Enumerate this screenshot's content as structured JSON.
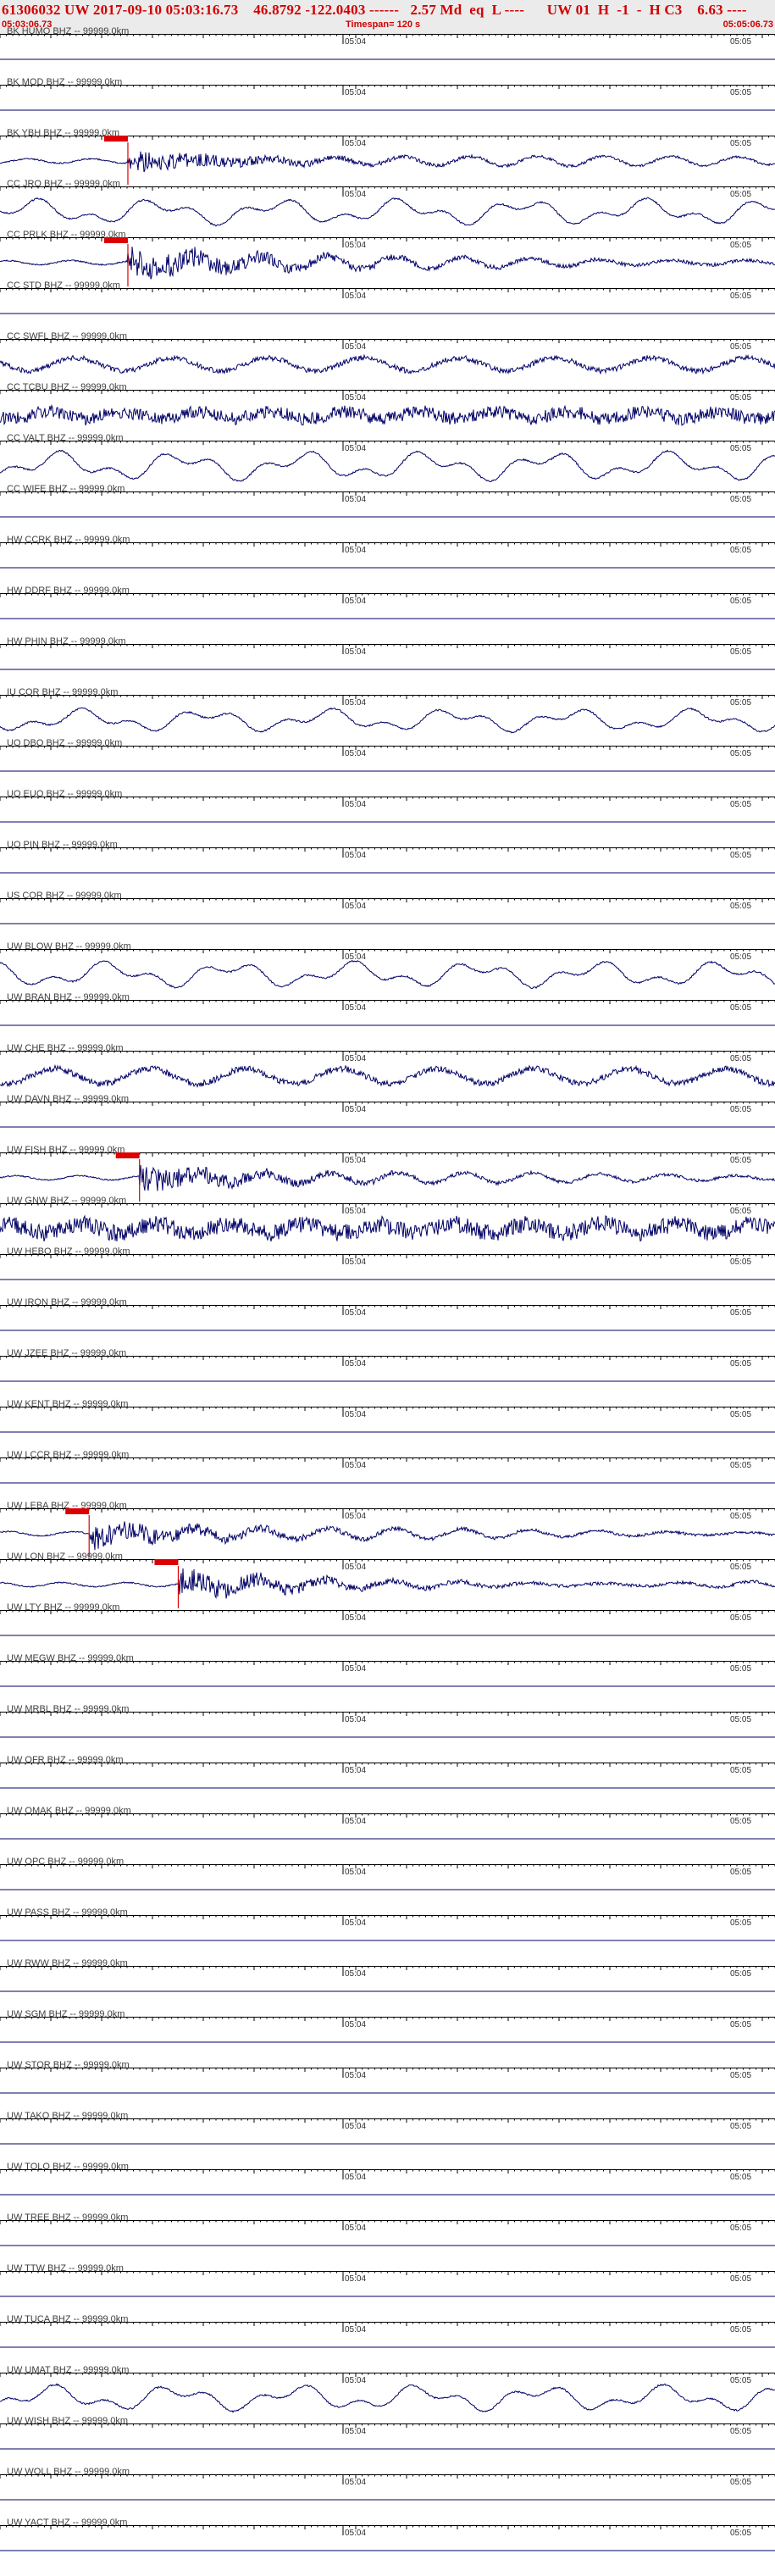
{
  "header": {
    "title": "61306032 UW 2017-09-10 05:03:16.73    46.8792 -122.0403 ------   2.57 Md  eq  L ----      UW 01  H  -1  -  H C3    6.63 ----",
    "start_time": "05:03:06.73",
    "timespan": "Timespan= 120 s",
    "end_time": "05:05:06.73"
  },
  "time_marks": {
    "mid": "05:04",
    "end": "05:05"
  },
  "colors": {
    "trace": "#000066",
    "pick": "#dd0000",
    "axis": "#000000",
    "header_text": "#d00000"
  },
  "stations": [
    {
      "label": "BK HUMO BHZ -- 99999.0km",
      "amp": 0,
      "style": "flat",
      "pick": null
    },
    {
      "label": "BK MOD BHZ -- 99999.0km",
      "amp": 0,
      "style": "flat",
      "pick": null
    },
    {
      "label": "BK YBH BHZ -- 99999.0km",
      "amp": 14,
      "style": "burst",
      "pick": 0.165
    },
    {
      "label": "CC JRO BHZ -- 99999.0km",
      "amp": 16,
      "style": "long",
      "pick": null
    },
    {
      "label": "CC PRLK BHZ -- 99999.0km",
      "amp": 20,
      "style": "burst",
      "pick": 0.165
    },
    {
      "label": "CC STD BHZ -- 99999.0km",
      "amp": 0,
      "style": "flat",
      "pick": null
    },
    {
      "label": "CC SWFL BHZ -- 99999.0km",
      "amp": 14,
      "style": "wave",
      "pick": null
    },
    {
      "label": "CC TCBU BHZ -- 99999.0km",
      "amp": 14,
      "style": "noise",
      "pick": null
    },
    {
      "label": "CC VALT BHZ -- 99999.0km",
      "amp": 18,
      "style": "long",
      "pick": null
    },
    {
      "label": "CC WIFE BHZ -- 99999.0km",
      "amp": 0,
      "style": "flat",
      "pick": null
    },
    {
      "label": "HW CCRK BHZ -- 99999.0km",
      "amp": 0,
      "style": "flat",
      "pick": null
    },
    {
      "label": "HW DDRF BHZ -- 99999.0km",
      "amp": 0,
      "style": "flat",
      "pick": null
    },
    {
      "label": "HW PHIN BHZ -- 99999.0km",
      "amp": 0,
      "style": "flat",
      "pick": null
    },
    {
      "label": "IU COR BHZ -- 99999.0km",
      "amp": 14,
      "style": "long",
      "pick": null
    },
    {
      "label": "UO DBO BHZ -- 99999.0km",
      "amp": 0,
      "style": "flat",
      "pick": null
    },
    {
      "label": "UO EUO BHZ -- 99999.0km",
      "amp": 0,
      "style": "flat",
      "pick": null
    },
    {
      "label": "UO PIN BHZ -- 99999.0km",
      "amp": 0,
      "style": "flat",
      "pick": null
    },
    {
      "label": "US COR BHZ -- 99999.0km",
      "amp": 0,
      "style": "flat",
      "pick": null
    },
    {
      "label": "UW BLOW BHZ -- 99999.0km",
      "amp": 16,
      "style": "long",
      "pick": null
    },
    {
      "label": "UW BRAN BHZ -- 99999.0km",
      "amp": 0,
      "style": "flat",
      "pick": null
    },
    {
      "label": "UW CHE BHZ -- 99999.0km",
      "amp": 16,
      "style": "wave",
      "pick": null
    },
    {
      "label": "UW DAVN BHZ -- 99999.0km",
      "amp": 0,
      "style": "flat",
      "pick": null
    },
    {
      "label": "UW FISH BHZ -- 99999.0km",
      "amp": 16,
      "style": "burst",
      "pick": 0.18
    },
    {
      "label": "UW GNW BHZ -- 99999.0km",
      "amp": 18,
      "style": "noise",
      "pick": null
    },
    {
      "label": "UW HEBO BHZ -- 99999.0km",
      "amp": 0,
      "style": "flat",
      "pick": null
    },
    {
      "label": "UW IRON BHZ -- 99999.0km",
      "amp": 0,
      "style": "flat",
      "pick": null
    },
    {
      "label": "UW JZEE BHZ -- 99999.0km",
      "amp": 0,
      "style": "flat",
      "pick": null
    },
    {
      "label": "UW KENT BHZ -- 99999.0km",
      "amp": 0,
      "style": "flat",
      "pick": null
    },
    {
      "label": "UW LCCR BHZ -- 99999.0km",
      "amp": 0,
      "style": "flat",
      "pick": null
    },
    {
      "label": "UW LEBA BHZ -- 99999.0km",
      "amp": 16,
      "style": "burst",
      "pick": 0.115
    },
    {
      "label": "UW LON BHZ -- 99999.0km",
      "amp": 16,
      "style": "burst",
      "pick": 0.23
    },
    {
      "label": "UW LTY BHZ -- 99999.0km",
      "amp": 0,
      "style": "flat",
      "pick": null
    },
    {
      "label": "UW MEGW BHZ -- 99999.0km",
      "amp": 0,
      "style": "flat",
      "pick": null
    },
    {
      "label": "UW MRBL BHZ -- 99999.0km",
      "amp": 0,
      "style": "flat",
      "pick": null
    },
    {
      "label": "UW OFR BHZ -- 99999.0km",
      "amp": 0,
      "style": "flat",
      "pick": null
    },
    {
      "label": "UW OMAK BHZ -- 99999.0km",
      "amp": 0,
      "style": "flat",
      "pick": null
    },
    {
      "label": "UW OPC BHZ -- 99999.0km",
      "amp": 0,
      "style": "flat",
      "pick": null
    },
    {
      "label": "UW PASS BHZ -- 99999.0km",
      "amp": 0,
      "style": "flat",
      "pick": null
    },
    {
      "label": "UW RWW BHZ -- 99999.0km",
      "amp": 0,
      "style": "flat",
      "pick": null
    },
    {
      "label": "UW SGM BHZ -- 99999.0km",
      "amp": 0,
      "style": "flat",
      "pick": null
    },
    {
      "label": "UW STOR BHZ -- 99999.0km",
      "amp": 0,
      "style": "flat",
      "pick": null
    },
    {
      "label": "UW TAKO BHZ -- 99999.0km",
      "amp": 0,
      "style": "flat",
      "pick": null
    },
    {
      "label": "UW TOLO BHZ -- 99999.0km",
      "amp": 0,
      "style": "flat",
      "pick": null
    },
    {
      "label": "UW TREE BHZ -- 99999.0km",
      "amp": 0,
      "style": "flat",
      "pick": null
    },
    {
      "label": "UW TTW BHZ -- 99999.0km",
      "amp": 0,
      "style": "flat",
      "pick": null
    },
    {
      "label": "UW TUCA BHZ -- 99999.0km",
      "amp": 0,
      "style": "flat",
      "pick": null
    },
    {
      "label": "UW UMAT BHZ -- 99999.0km",
      "amp": 16,
      "style": "long",
      "pick": null
    },
    {
      "label": "UW WISH BHZ -- 99999.0km",
      "amp": 0,
      "style": "flat",
      "pick": null
    },
    {
      "label": "UW WOLL BHZ -- 99999.0km",
      "amp": 0,
      "style": "flat",
      "pick": null
    },
    {
      "label": "UW YACT BHZ -- 99999.0km",
      "amp": 0,
      "style": "flat",
      "pick": null
    }
  ]
}
